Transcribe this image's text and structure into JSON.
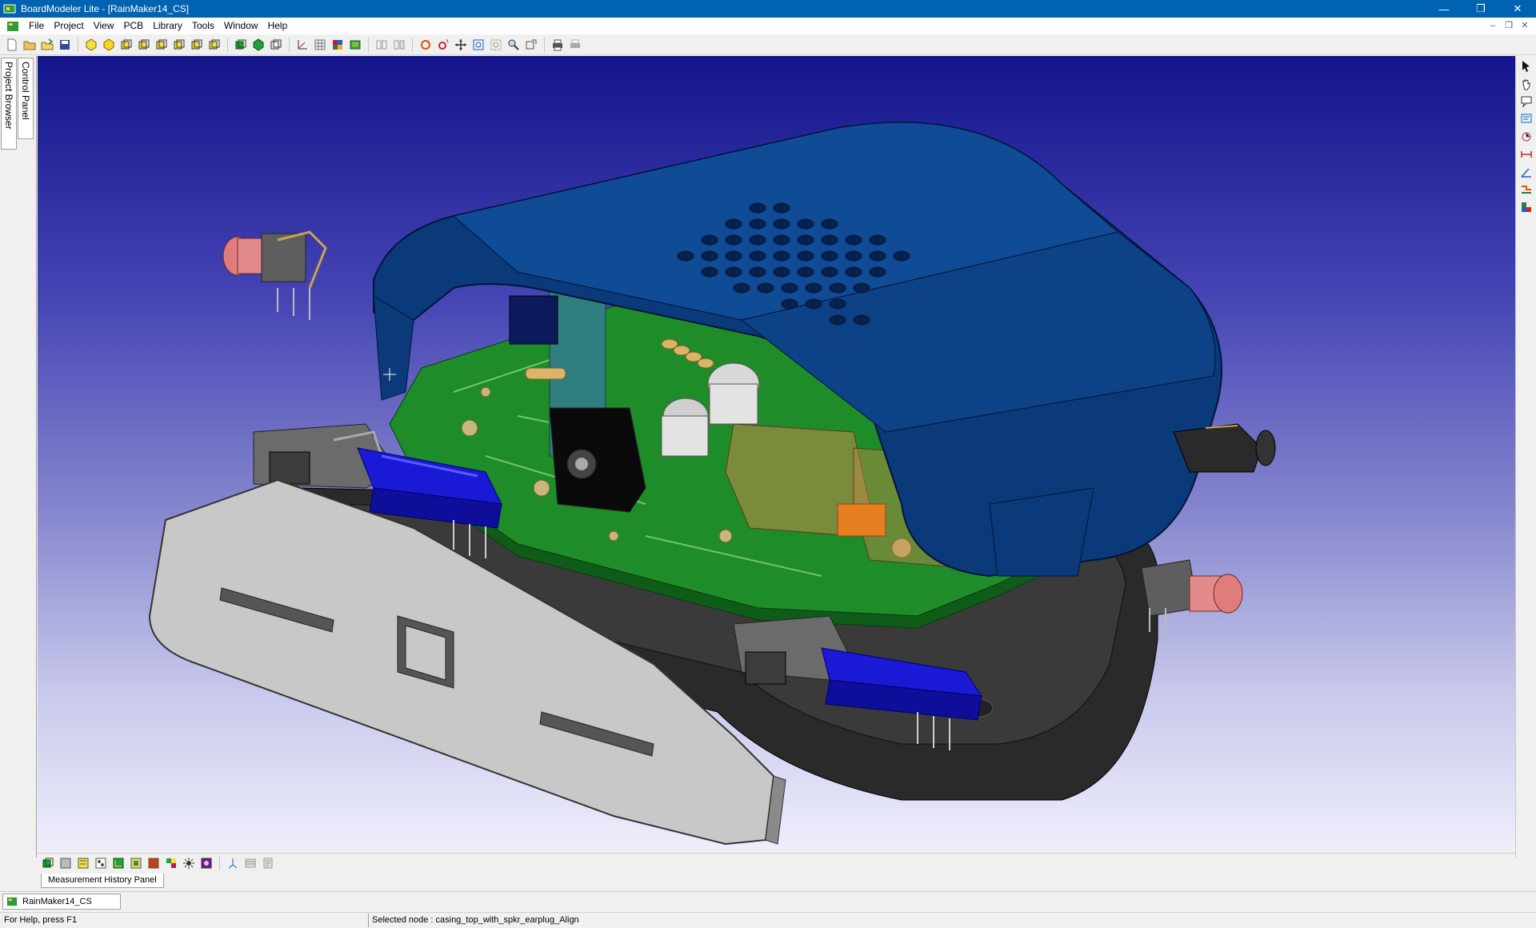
{
  "window": {
    "title": "BoardModeler Lite - [RainMaker14_CS]",
    "controls": [
      "minimize",
      "restore",
      "close"
    ]
  },
  "menu": {
    "items": [
      "File",
      "Project",
      "View",
      "PCB",
      "Library",
      "Tools",
      "Window",
      "Help"
    ]
  },
  "left_dock": {
    "tabs": [
      "Project Browser",
      "Control Panel"
    ]
  },
  "bottom_panel": {
    "measurement_tab": "Measurement History Panel"
  },
  "document_tabs": {
    "active": "RainMaker14_CS"
  },
  "status": {
    "help": "For Help, press F1",
    "selected_node": "Selected node : casing_top_with_spkr_earplug_Align"
  },
  "colors": {
    "titlebar": "#0063b1",
    "viewport_top": "#14148c",
    "viewport_bottom": "#eeeefc",
    "casing_top": "#0b3a7a",
    "pcb_green": "#1f8c2a",
    "side_panel": "#c8c8c8",
    "connector_blue": "#1a1ad6"
  }
}
